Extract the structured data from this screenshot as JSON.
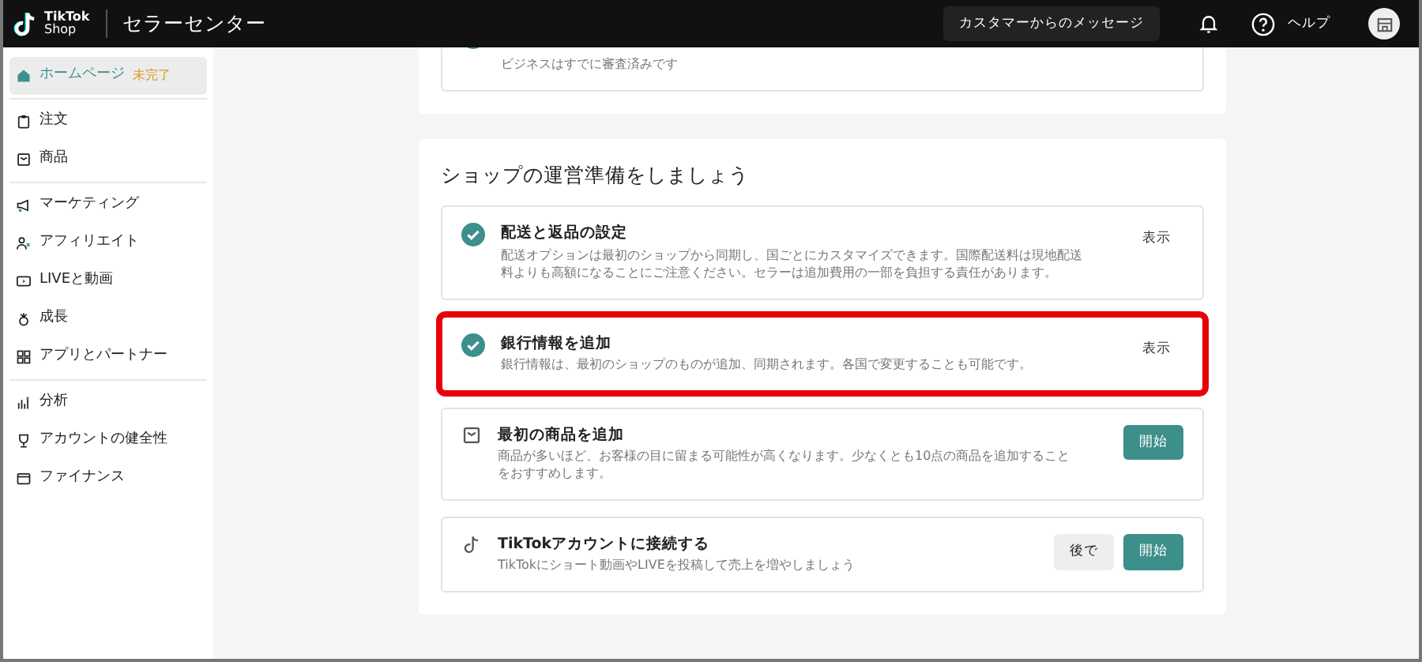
{
  "header": {
    "logo_line1": "TikTok",
    "logo_line2": "Shop",
    "title": "セラーセンター",
    "message_button": "カスタマーからのメッセージ",
    "help": "ヘルプ"
  },
  "sidebar": {
    "groups": [
      [
        {
          "label": "ホームページ",
          "selected": true,
          "badge": "未完了"
        }
      ],
      [
        {
          "label": "注文",
          "selected": false
        },
        {
          "label": "商品",
          "selected": false
        }
      ],
      [
        {
          "label": "マーケティング",
          "selected": false
        },
        {
          "label": "アフィリエイト",
          "selected": false
        },
        {
          "label": "LIVEと動画",
          "selected": false
        },
        {
          "label": "成長",
          "selected": false
        },
        {
          "label": "アプリとパートナー",
          "selected": false
        }
      ],
      [
        {
          "label": "分析",
          "selected": false
        },
        {
          "label": "アカウントの健全性",
          "selected": false
        },
        {
          "label": "ファイナンス",
          "selected": false
        }
      ]
    ]
  },
  "previous_card": {
    "desc": "ビジネスはすでに審査済みです"
  },
  "setup": {
    "title": "ショップの運営準備をしましょう",
    "tasks": [
      {
        "title": "配送と返品の設定",
        "desc": "配送オプションは最初のショップから同期し、国ごとにカスタマイズできます。国際配送料は現地配送料よりも高額になることにご注意ください。セラーは追加費用の一部を負担する責任があります。",
        "done": true,
        "highlighted": false,
        "actions": [
          {
            "label": "表示",
            "kind": "link"
          }
        ]
      },
      {
        "title": "銀行情報を追加",
        "desc": "銀行情報は、最初のショップのものが追加、同期されます。各国で変更することも可能です。",
        "done": true,
        "highlighted": true,
        "actions": [
          {
            "label": "表示",
            "kind": "link"
          }
        ]
      },
      {
        "title": "最初の商品を追加",
        "desc": "商品が多いほど、お客様の目に留まる可能性が高くなります。少なくとも10点の商品を追加することをおすすめします。",
        "done": false,
        "highlighted": false,
        "actions": [
          {
            "label": "開始",
            "kind": "primary"
          }
        ]
      },
      {
        "title": "TikTokアカウントに接続する",
        "desc": "TikTokにショート動画やLIVEを投稿して売上を増やしましょう",
        "done": false,
        "highlighted": false,
        "actions": [
          {
            "label": "後で",
            "kind": "secondary"
          },
          {
            "label": "開始",
            "kind": "primary"
          }
        ]
      }
    ]
  }
}
